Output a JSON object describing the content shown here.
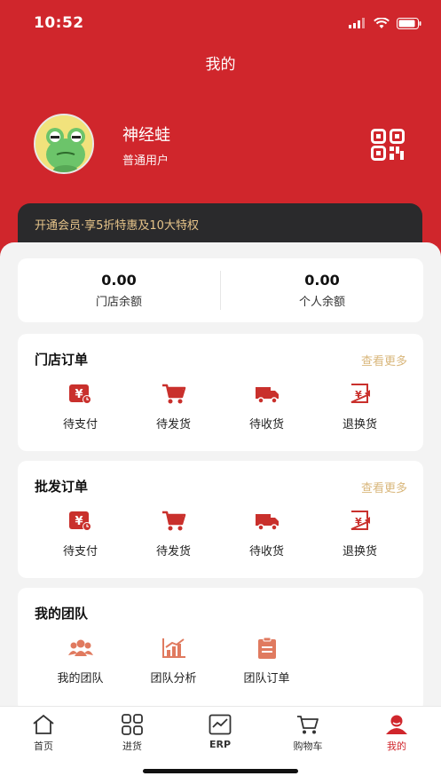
{
  "status": {
    "time": "10:52"
  },
  "page_title": "我的",
  "user": {
    "name": "神经蛙",
    "role": "普通用户"
  },
  "vip_banner": "开通会员·享5折特惠及10大特权",
  "balance": [
    {
      "value": "0.00",
      "label": "门店余额"
    },
    {
      "value": "0.00",
      "label": "个人余额"
    }
  ],
  "store_orders": {
    "title": "门店订单",
    "more": "查看更多",
    "items": [
      {
        "label": "待支付",
        "icon": "payment-icon"
      },
      {
        "label": "待发货",
        "icon": "cart-icon"
      },
      {
        "label": "待收货",
        "icon": "truck-icon"
      },
      {
        "label": "退换货",
        "icon": "return-icon"
      }
    ]
  },
  "wholesale_orders": {
    "title": "批发订单",
    "more": "查看更多",
    "items": [
      {
        "label": "待支付",
        "icon": "payment-icon"
      },
      {
        "label": "待发货",
        "icon": "cart-icon"
      },
      {
        "label": "待收货",
        "icon": "truck-icon"
      },
      {
        "label": "退换货",
        "icon": "return-icon"
      }
    ]
  },
  "team": {
    "title": "我的团队",
    "items": [
      {
        "label": "我的团队",
        "icon": "people-icon"
      },
      {
        "label": "团队分析",
        "icon": "chart-icon"
      },
      {
        "label": "团队订单",
        "icon": "clipboard-icon"
      }
    ]
  },
  "tabs": [
    {
      "label": "首页",
      "icon": "home-icon"
    },
    {
      "label": "进货",
      "icon": "grid-icon"
    },
    {
      "label": "ERP",
      "icon": "erp-icon"
    },
    {
      "label": "购物车",
      "icon": "cart-icon"
    },
    {
      "label": "我的",
      "icon": "user-icon",
      "active": true
    }
  ],
  "colors": {
    "brand": "#d0262c",
    "vip_text": "#e6c48a",
    "more": "#d9b77c"
  }
}
